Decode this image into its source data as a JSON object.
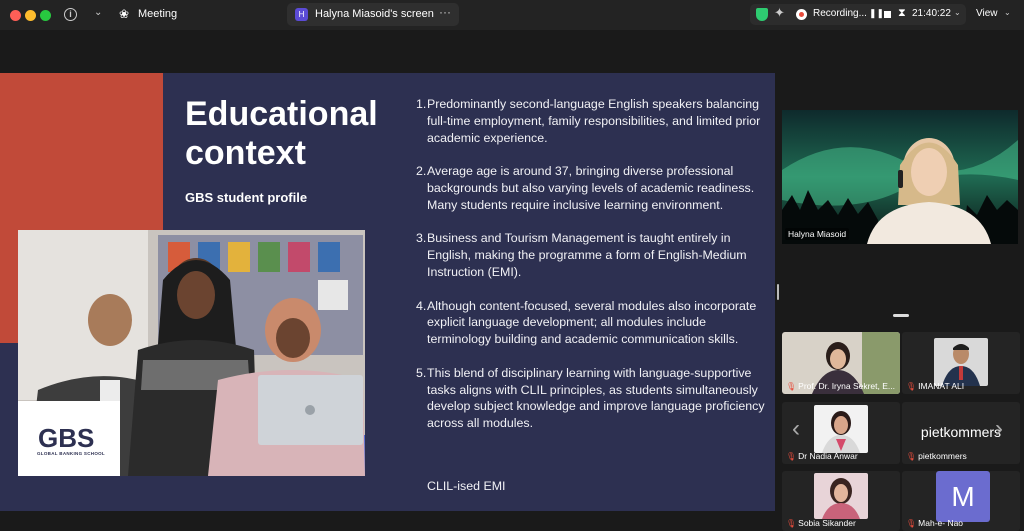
{
  "topbar": {
    "meeting_label": "Meeting",
    "share_tab_label": "Halyna Miasoid's screen",
    "share_avatar_initial": "H",
    "recording_label": "Recording...",
    "timer": "21:40:22",
    "view_label": "View"
  },
  "slide": {
    "title": "Educational context",
    "subtitle": "GBS student profile",
    "items": [
      {
        "num": "1.",
        "text": "Predominantly second-language English speakers balancing full-time employment, family responsibilities, and limited prior academic experience."
      },
      {
        "num": "2.",
        "text": "Average age is around 37, bringing diverse professional backgrounds but also varying levels of academic readiness. Many students require inclusive learning environment."
      },
      {
        "num": "3.",
        "text": "Business and Tourism Management is taught entirely in English, making the programme a form of English-Medium Instruction (EMI)."
      },
      {
        "num": "4.",
        "text": "Although content-focused, several modules also incorporate explicit language development; all modules include terminology building and academic communication skills."
      },
      {
        "num": "5.",
        "text": "This blend of disciplinary learning with language-supportive tasks aligns with CLIL principles, as students simultaneously develop subject knowledge and improve language proficiency across all modules."
      }
    ],
    "footer": "CLIL-ised EMI",
    "logo_text": "GBS",
    "logo_tagline": "GLOBAL BANKING SCHOOL"
  },
  "speaker": {
    "name": "Halyna Miasoid"
  },
  "participants": [
    {
      "name": "Prof. Dr. Iryna Sekret, E..."
    },
    {
      "name": "IMANAT ALI"
    },
    {
      "name": "Dr Nadia Anwar"
    },
    {
      "name": "pietkommers",
      "display_text": "pietkommers"
    },
    {
      "name": "Sobia Sikander"
    },
    {
      "name": "Mah-e- Nao",
      "initial": "M"
    }
  ],
  "colors": {
    "slide_bg": "#2d3051",
    "slide_accent": "#c14a39",
    "avatar_purple": "#6b6ccf"
  }
}
